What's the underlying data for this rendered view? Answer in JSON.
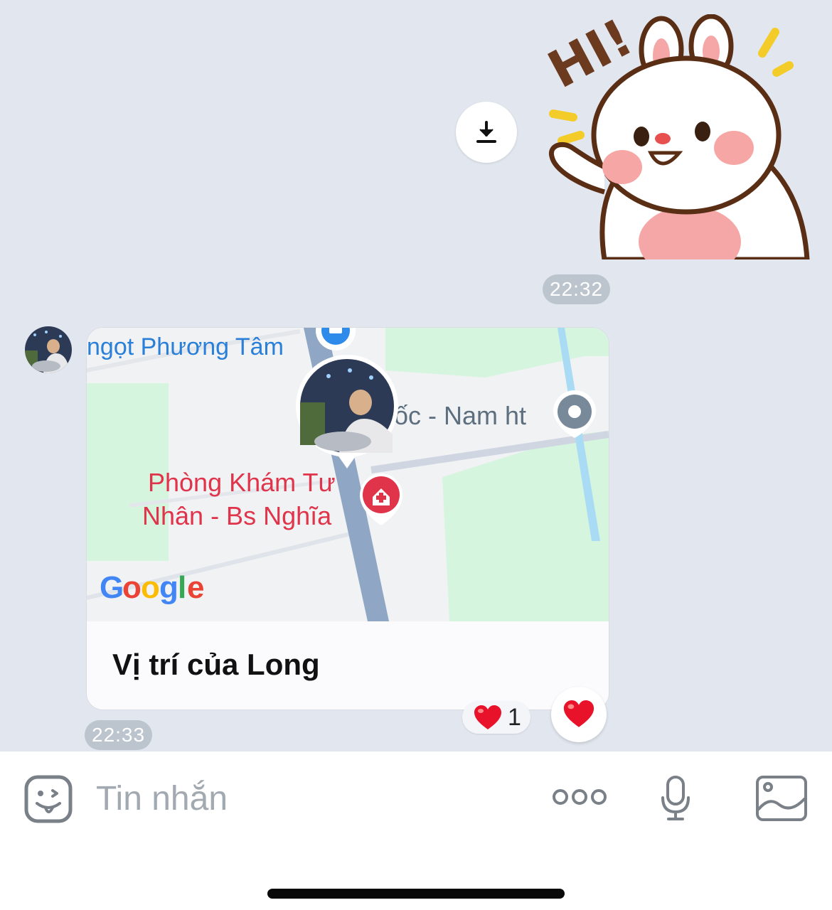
{
  "thread": {
    "sticker": {
      "name": "bunny-hi-sticker",
      "text": "HI!"
    },
    "sticker_time": "22:32",
    "location_message": {
      "map_labels": {
        "place_top": "ngọt Phương Tâm",
        "place_right": "ốc - Nam ht",
        "clinic_line1": "Phòng Khám Tư",
        "clinic_line2": "Nhân - Bs Nghĩa",
        "map_provider": "Google"
      },
      "title": "Vị trí của Long",
      "time": "22:33"
    },
    "reactions": {
      "emoji": "heart",
      "count": "1"
    }
  },
  "composer": {
    "placeholder": "Tin nhắn"
  },
  "colors": {
    "background": "#e2e7ef",
    "timestamp_pill": "#bcc4ce",
    "clinic_red": "#e0344b",
    "map_blue_label": "#2a7fd8",
    "road": "#8fa6c4",
    "park_green": "#d6f5df"
  }
}
